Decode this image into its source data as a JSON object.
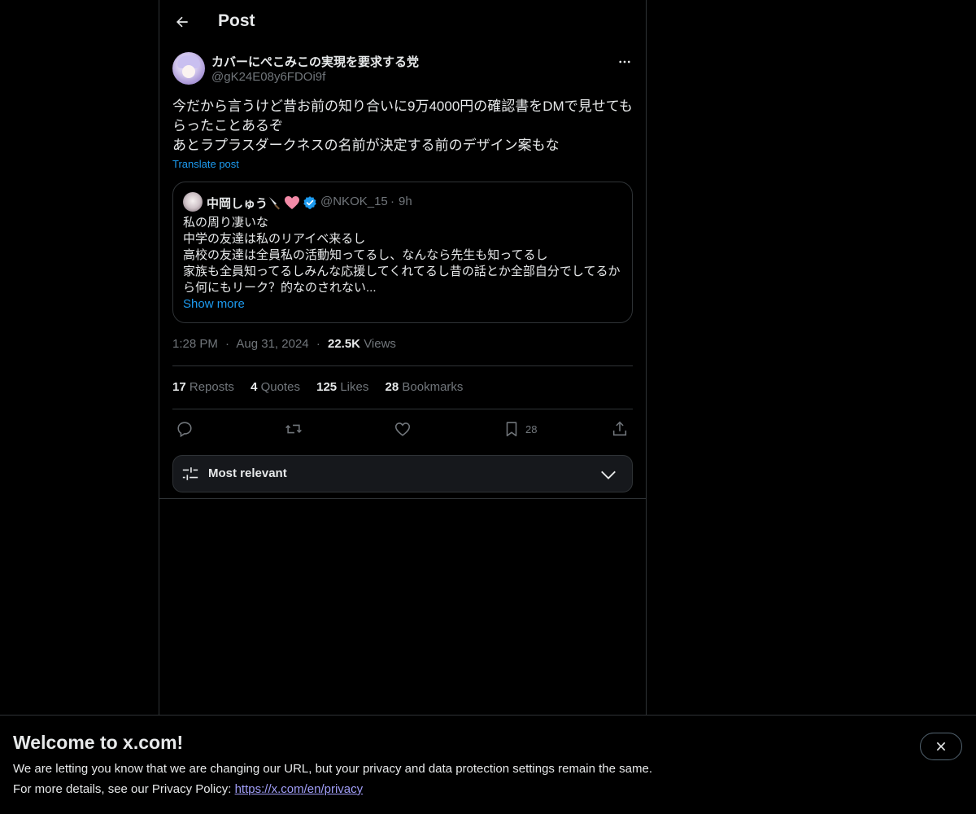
{
  "header": {
    "title": "Post"
  },
  "author": {
    "display_name": "カバーにぺこみこの実現を要求する党",
    "handle": "@gK24E08y6FDOi9f"
  },
  "tweet": {
    "lines": [
      "今だから言うけど昔お前の知り合いに9万4000円の確認書をDMで見せてもらったことあるぞ",
      "あとラプラスダークネスの名前が決定する前のデザイン案もな"
    ],
    "translate_label": "Translate post"
  },
  "quote": {
    "name": "中岡しゅう",
    "emoji_icons": [
      "knife-icon",
      "pink-heart-icon"
    ],
    "handle": "@NKOK_15",
    "dot": "·",
    "time": "9h",
    "lines": [
      "私の周り凄いな",
      "中学の友達は私のリアイベ来るし",
      "高校の友達は全員私の活動知ってるし、なんなら先生も知ってるし",
      "家族も全員知ってるしみんな応援してくれてるし昔の話とか全部自分でしてるから何にもリーク？的なのされない..."
    ],
    "show_more": "Show more"
  },
  "meta": {
    "time": "1:28 PM",
    "dot": "·",
    "date": "Aug 31, 2024",
    "views_count": "22.5K",
    "views_label": "Views"
  },
  "stats": {
    "reposts_count": "17",
    "reposts_label": "Reposts",
    "quotes_count": "4",
    "quotes_label": "Quotes",
    "likes_count": "125",
    "likes_label": "Likes",
    "bookmarks_count": "28",
    "bookmarks_label": "Bookmarks"
  },
  "actions": {
    "bookmark_count": "28"
  },
  "sort": {
    "label": "Most relevant"
  },
  "banner": {
    "title": "Welcome to x.com!",
    "line1": "We are letting you know that we are changing our URL, but your privacy and data protection settings remain the same.",
    "line2_prefix": "For more details, see our Privacy Policy: ",
    "link": "https://x.com/en/privacy"
  },
  "colors": {
    "background": "#000000",
    "text": "#e7e9ea",
    "secondary": "#71767b",
    "accent": "#1d9bf0",
    "border": "#2f3336",
    "link": "#a19ef8"
  }
}
